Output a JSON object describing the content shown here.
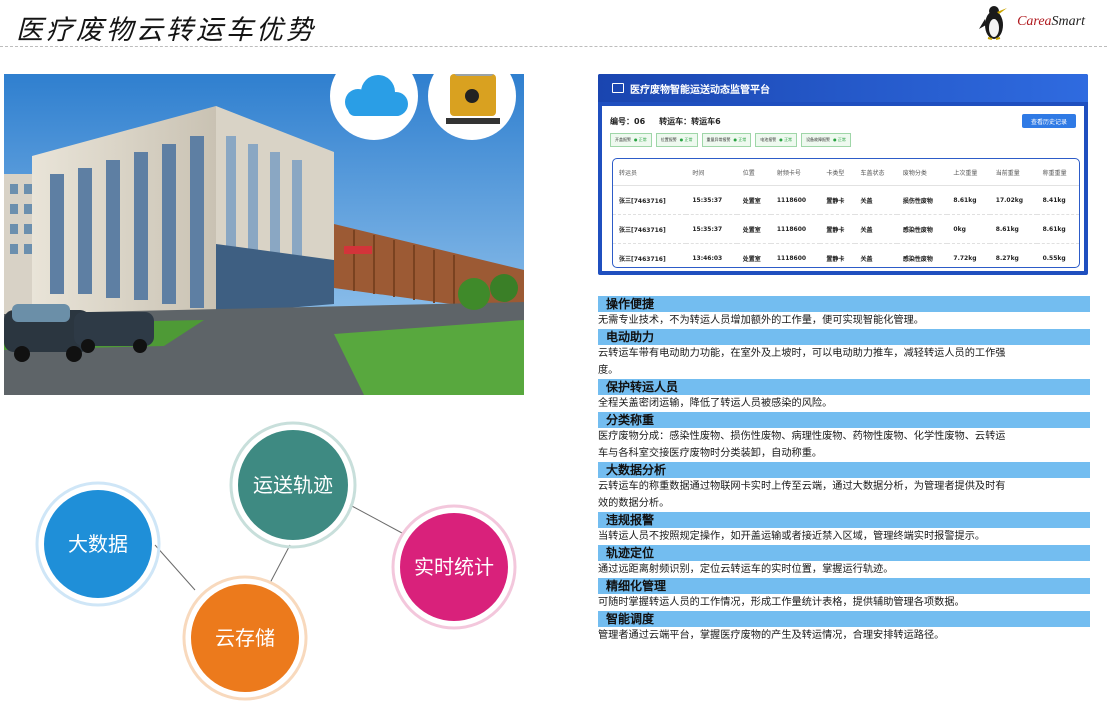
{
  "page_title": "医疗废物云转运车优势",
  "logo": {
    "brand": "Carea",
    "brand2": "Smart"
  },
  "panel": {
    "title": "医疗废物智能运送动态监管平台",
    "number_label": "编号：06",
    "vehicle_label": "转运车：转运车6",
    "history_button": "查看历史记录",
    "sensors": [
      {
        "label": "开盖报警",
        "status": "正常"
      },
      {
        "label": "位置报警",
        "status": "正常"
      },
      {
        "label": "重量异常报警",
        "status": "正常"
      },
      {
        "label": "电池报警",
        "status": "正常"
      },
      {
        "label": "设备故障报警",
        "status": "正常"
      }
    ],
    "columns": [
      "转运员",
      "时间",
      "位置",
      "射频卡号",
      "卡类型",
      "车盖状态",
      "废物分类",
      "上次重量",
      "当前重量",
      "称重重量"
    ],
    "rows": [
      [
        "张三[7463716]",
        "15:35:37",
        "处置室",
        "1118600",
        "置静卡",
        "关盖",
        "损伤性废物",
        "8.61kg",
        "17.02kg",
        "8.41kg"
      ],
      [
        "张三[7463716]",
        "15:35:37",
        "处置室",
        "1118600",
        "置静卡",
        "关盖",
        "感染性废物",
        "0kg",
        "8.61kg",
        "8.61kg"
      ],
      [
        "张三[7463716]",
        "13:46:03",
        "处置室",
        "1118600",
        "置静卡",
        "关盖",
        "感染性废物",
        "7.72kg",
        "8.27kg",
        "0.55kg"
      ]
    ]
  },
  "bubbles": {
    "big_data": "大数据",
    "track": "运送轨迹",
    "realtime": "实时统计",
    "storage": "云存储"
  },
  "colors": {
    "big_data": "#1f8fd8",
    "track": "#3e8a82",
    "realtime": "#d9217b",
    "storage": "#ec7a1c",
    "feature_bar": "#73bdf0",
    "panel_blue": "#1f4fbf"
  },
  "features": [
    {
      "title": "操作便捷",
      "desc": "无需专业技术，不为转运人员增加额外的工作量，便可实现智能化管理。"
    },
    {
      "title": "电动助力",
      "desc": "云转运车带有电动助力功能，在室外及上坡时，可以电动助力推车，减轻转运人员的工作强度。"
    },
    {
      "title": "保护转运人员",
      "desc": "全程关盖密闭运输，降低了转运人员被感染的风险。"
    },
    {
      "title": "分类称重",
      "desc": "医疗废物分成：感染性废物、损伤性废物、病理性废物、药物性废物、化学性废物、云转运车与各科室交接医疗废物时分类装卸，自动称重。"
    },
    {
      "title": "大数据分析",
      "desc": "云转运车的称重数据通过物联网卡实时上传至云端，通过大数据分析，为管理者提供及时有效的数据分析。"
    },
    {
      "title": "违规报警",
      "desc": "当转运人员不按照规定操作，如开盖运输或者接近禁入区域，管理终端实时报警提示。"
    },
    {
      "title": "轨迹定位",
      "desc": "通过远距离射频识别，定位云转运车的实时位置，掌握运行轨迹。"
    },
    {
      "title": "精细化管理",
      "desc": "可随时掌握转运人员的工作情况，形成工作量统计表格，提供辅助管理各项数据。"
    },
    {
      "title": "智能调度",
      "desc": "管理者通过云端平台，掌握医疗废物的产生及转运情况，合理安排转运路径。"
    }
  ]
}
